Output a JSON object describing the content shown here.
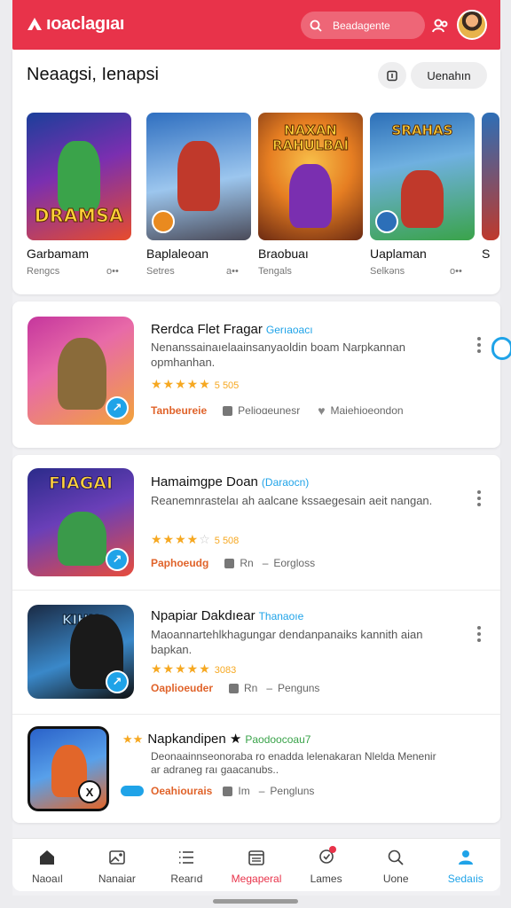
{
  "app": {
    "name": "ıoaclagıaı",
    "search_placeholder": "Beadagente"
  },
  "featured": {
    "title": "Neaagsi, Ienapsi",
    "pill_label": "Uenahın",
    "items": [
      {
        "name": "Garbamam",
        "sub": "Rengcs",
        "meta": "o••",
        "art_text": "DRAMSA",
        "colors": [
          "#1b3f9a",
          "#e74c2c",
          "#f1c232"
        ]
      },
      {
        "name": "Baplaleoan",
        "sub": "Setres",
        "meta": "a••",
        "art_text": "",
        "colors": [
          "#2f6fc0",
          "#b8d4f0",
          "#c0392b"
        ]
      },
      {
        "name": "Braobuaı",
        "sub": "Tengals",
        "meta": "",
        "art_text": "NAXAN RAHULBAİ",
        "colors": [
          "#e67e22",
          "#6b2a12",
          "#f8c14a"
        ]
      },
      {
        "name": "Uaplaman",
        "sub": "Selkəns",
        "meta": "o••",
        "art_text": "SRAHAS",
        "colors": [
          "#3aa34a",
          "#2c6fb8",
          "#f1c232"
        ]
      },
      {
        "name": "S",
        "sub": "",
        "meta": "",
        "art_text": "",
        "colors": [
          "#c0392b",
          "#2c6fb8",
          "#f1c232"
        ]
      }
    ]
  },
  "list": [
    {
      "title": "Rerdca Flet Fragar",
      "tag": "Gerıaoacı",
      "desc": "Nenanssainaıelaainsanyaoldin boam Narpkannan opmhanhan.",
      "stars_full": 5,
      "stars_total": 5,
      "rating": "5 505",
      "category": "Tanbeureie",
      "meta1": "Pelioɑeunesr",
      "meta2": "Maiehioeondon",
      "thumb_text": "",
      "colors": [
        "#c5369d",
        "#f2a33a",
        "#6b4b2a"
      ]
    },
    {
      "title": "Hamaimgpe Doan",
      "tag": "(Daraocn)",
      "desc": "Reanemnrastelaı ah aalcane kssaegesain aeit nangan.",
      "stars_full": 4,
      "stars_total": 5,
      "rating": "5 508",
      "category": "Paphoeudg",
      "meta1": "Rn",
      "meta2": "Eorgloss",
      "thumb_text": "FIAGAI",
      "colors": [
        "#2b2b8a",
        "#e74c3c",
        "#f1c232"
      ]
    },
    {
      "title": "Npapiar Dakdıear",
      "tag": "Thanaoıe",
      "desc": "Maoannartehlkhagungar dendanpanaiks kannith aian bapkan.",
      "stars_full": 5,
      "stars_total": 5,
      "rating": "3083",
      "category": "Oaplioeuder",
      "meta1": "Rn",
      "meta2": "Penguns",
      "thumb_text": "KIHH",
      "colors": [
        "#1a2a44",
        "#3a88c9",
        "#101010"
      ]
    },
    {
      "title": "Napkandipen ★",
      "tag": "Paodoocoau7",
      "desc": "Deonaainnseonoraba ro enadda lelenakaran Nlelda Menenir ar adraneg raı gaacanubs..",
      "stars_full": 0,
      "stars_total": 0,
      "rating": "",
      "category": "Oeahiourais",
      "meta1": "Im",
      "meta2": "Pengluns",
      "thumb_text": "",
      "colors": [
        "#2a62c9",
        "#e2662a",
        "#f1c232"
      ]
    }
  ],
  "bottom_nav": [
    {
      "label": "Naoaıl",
      "icon": "home-icon"
    },
    {
      "label": "Nanaiar",
      "icon": "image-icon"
    },
    {
      "label": "Rearıd",
      "icon": "list-icon"
    },
    {
      "label": "Megaperal",
      "icon": "calendar-icon"
    },
    {
      "label": "Lames",
      "icon": "location-heart-icon"
    },
    {
      "label": "Uone",
      "icon": "search-icon"
    },
    {
      "label": "Sedaıis",
      "icon": "person-icon"
    }
  ],
  "colors": {
    "brand": "#e8334a",
    "accent": "#1fa3e8",
    "star": "#f6a821",
    "category": "#e0632a"
  }
}
